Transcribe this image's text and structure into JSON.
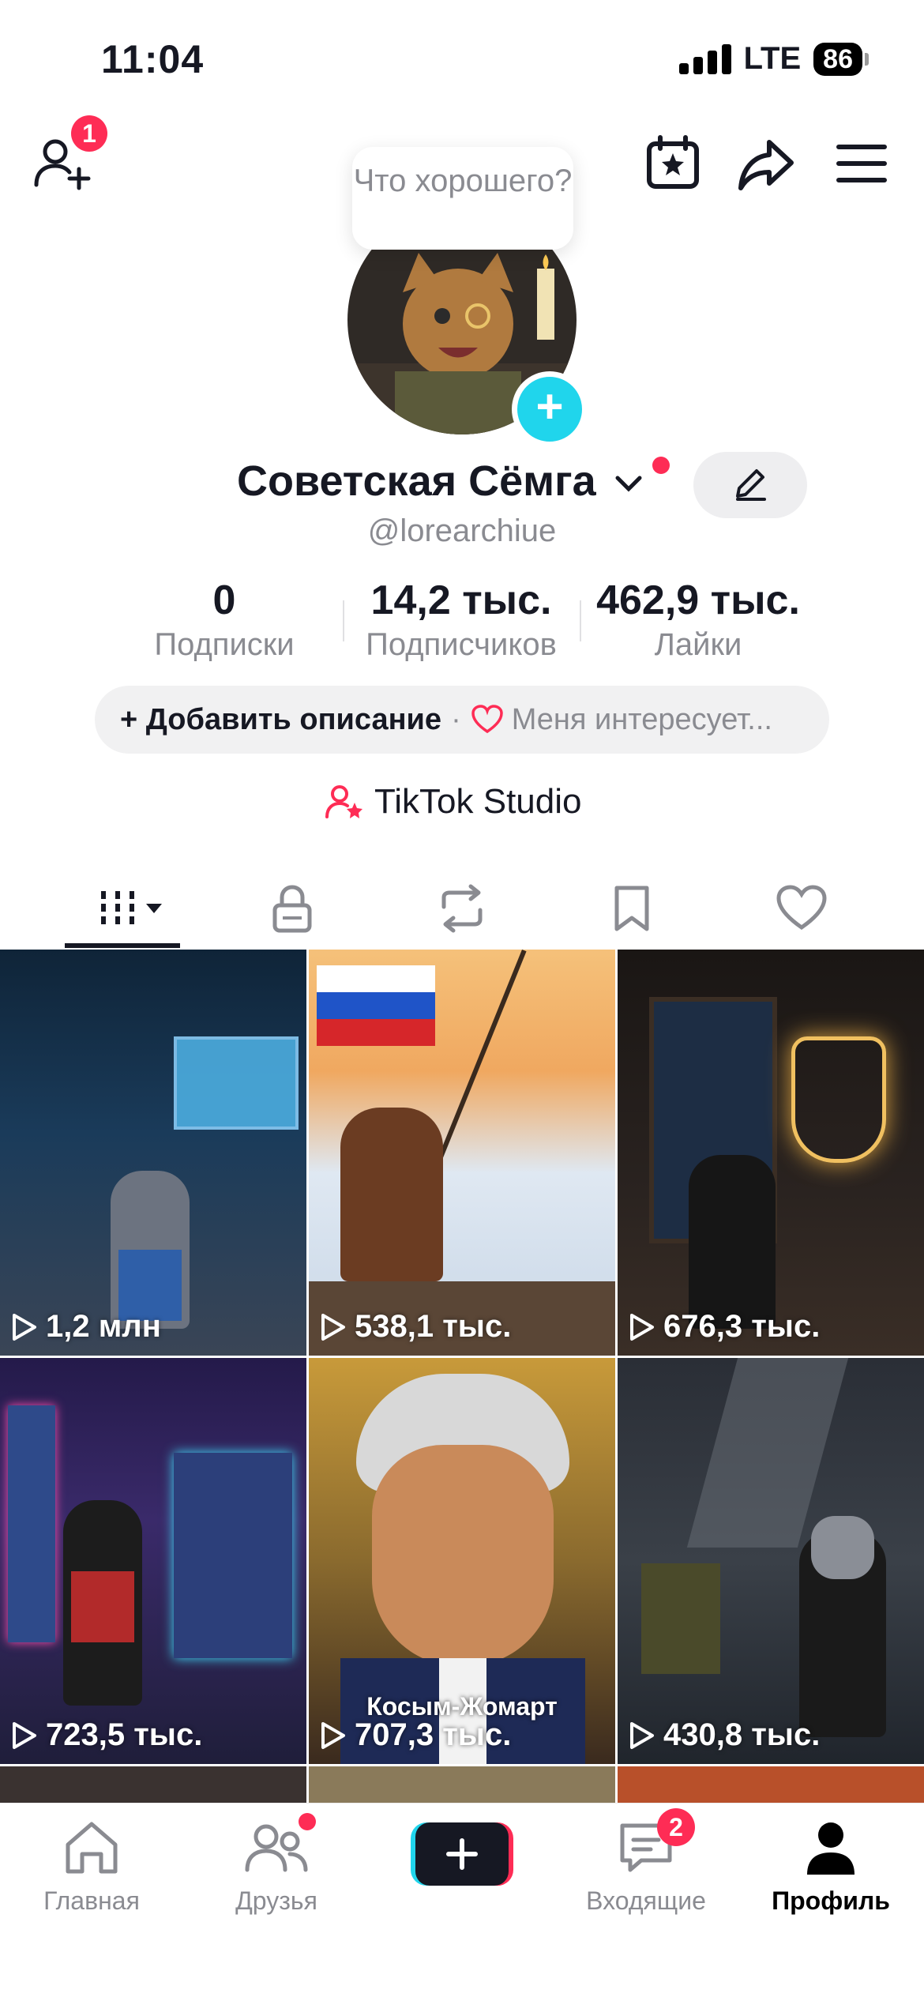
{
  "status_bar": {
    "time": "11:04",
    "network": "LTE",
    "battery": "86"
  },
  "top_bar": {
    "friends_badge": "1"
  },
  "bubble": {
    "text": "Что хорошего?"
  },
  "profile": {
    "display_name": "Советская Сёмга",
    "username": "@lorearchiue"
  },
  "stats": [
    {
      "value": "0",
      "label": "Подписки"
    },
    {
      "value": "14,2 тыс.",
      "label": "Подписчиков"
    },
    {
      "value": "462,9 тыс.",
      "label": "Лайки"
    }
  ],
  "bio": {
    "add_label": "+ Добавить описание",
    "separator": "·",
    "interest_label": "Меня интересует..."
  },
  "studio": {
    "label": "TikTok Studio"
  },
  "videos": [
    {
      "views": "1,2 млн",
      "caption": ""
    },
    {
      "views": "538,1 тыс.",
      "caption": ""
    },
    {
      "views": "676,3 тыс.",
      "caption": ""
    },
    {
      "views": "723,5 тыс.",
      "caption": ""
    },
    {
      "views": "707,3 тыс.",
      "caption": "Косым-Жомарт"
    },
    {
      "views": "430,8 тыс.",
      "caption": ""
    }
  ],
  "nav": {
    "home": "Главная",
    "friends": "Друзья",
    "inbox": "Входящие",
    "inbox_badge": "2",
    "profile": "Профиль"
  },
  "colors": {
    "accent": "#fe2c55",
    "cyan": "#20d5ec",
    "text": "#161823",
    "muted": "#8a8b91"
  }
}
